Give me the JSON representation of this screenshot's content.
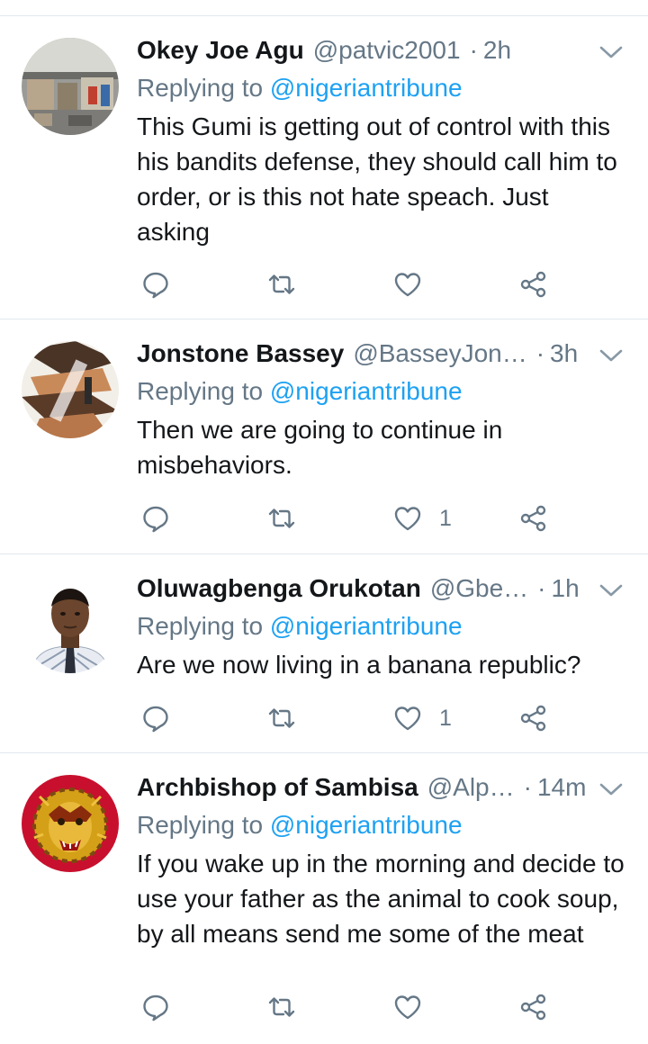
{
  "colors": {
    "text": "#14171a",
    "muted": "#657786",
    "link": "#1da1f2",
    "divider": "#e1e8ed"
  },
  "tweets": [
    {
      "name": "Okey Joe Agu",
      "handle": "@patvic2001",
      "separator": "·",
      "time": "2h",
      "replying_prefix": "Replying to ",
      "replying_to": "@nigeriantribune",
      "text": "This Gumi is getting out of control with this his bandits defense, they should call him to order, or is this not hate speach. Just asking",
      "like_count": "",
      "avatar_icon": "warehouse-photo"
    },
    {
      "name": "Jonstone Bassey",
      "handle": "@BasseyJon…",
      "separator": "·",
      "time": "3h",
      "replying_prefix": "Replying to ",
      "replying_to": "@nigeriantribune",
      "text": "Then we are going to continue in misbehaviors.",
      "like_count": "1",
      "avatar_icon": "collage-photo"
    },
    {
      "name": "Oluwagbenga Orukotan",
      "handle": "@Gbe…",
      "separator": "·",
      "time": "1h",
      "replying_prefix": "Replying to ",
      "replying_to": "@nigeriantribune",
      "text": "Are we now living in a banana republic?",
      "like_count": "1",
      "avatar_icon": "portrait-photo"
    },
    {
      "name": "Archbishop of Sambisa",
      "handle": "@Alp…",
      "separator": "·",
      "time": "14m",
      "replying_prefix": "Replying to ",
      "replying_to": "@nigeriantribune",
      "text": "If you wake up in the morning and decide to use your father as the animal to cook soup, by all means send me some of the meat",
      "like_count": "",
      "avatar_icon": "lion-emblem"
    }
  ]
}
